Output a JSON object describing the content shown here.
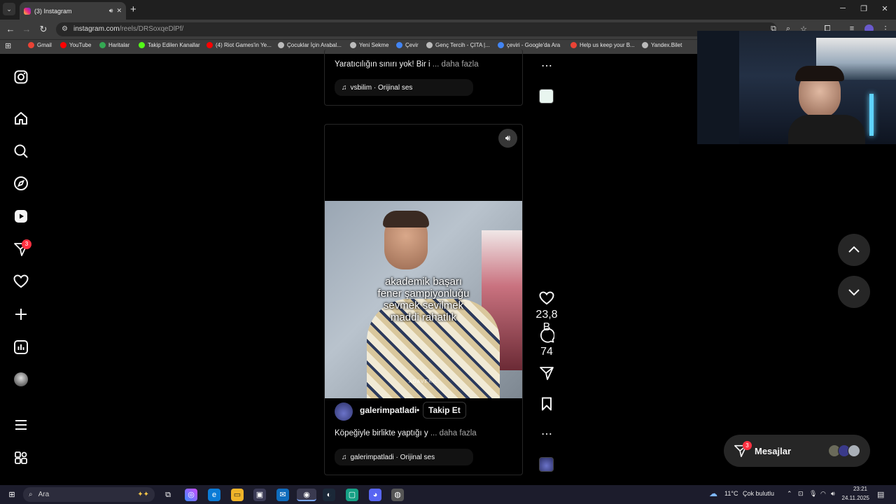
{
  "browser": {
    "tab_title": "(3) Instagram",
    "url_host": "instagram.com",
    "url_path": "/reels/DRSoxqeDlPf/",
    "bookmarks": [
      {
        "label": "Gmail",
        "icon": "gmail-icon",
        "color": "#ea4335"
      },
      {
        "label": "YouTube",
        "icon": "youtube-icon",
        "color": "#ff0000"
      },
      {
        "label": "Haritalar",
        "icon": "maps-icon",
        "color": "#34a853"
      },
      {
        "label": "Takip Edilen Kanallar",
        "icon": "kick-icon",
        "color": "#53fc18"
      },
      {
        "label": "(4) Riot Games'in Ye...",
        "icon": "youtube-icon",
        "color": "#ff0000"
      },
      {
        "label": "Çocuklar İçin Arabal...",
        "icon": "globe-icon",
        "color": "#bbbbbb"
      },
      {
        "label": "Yeni Sekme",
        "icon": "globe-icon",
        "color": "#bbbbbb"
      },
      {
        "label": "Çevir",
        "icon": "translate-icon",
        "color": "#4285f4"
      },
      {
        "label": "Genç Tercih - ÇITA |...",
        "icon": "globe-icon",
        "color": "#bbbbbb"
      },
      {
        "label": "çeviri - Google'da Ara",
        "icon": "google-icon",
        "color": "#4285f4"
      },
      {
        "label": "Help us keep your B...",
        "icon": "gmail-icon",
        "color": "#ea4335"
      },
      {
        "label": "Yandex.Bilet",
        "icon": "globe-icon",
        "color": "#bbbbbb"
      }
    ]
  },
  "sidebar": {
    "notification_count": "3"
  },
  "prev_post": {
    "caption": "Yaratıcılığın sınırı yok! Bir i",
    "more": "... daha fazla",
    "audio": "vsbilim · Orijinal ses"
  },
  "post": {
    "overlay_lines": [
      "akademik başarı",
      "fener şampiyonluğu",
      "sevmek sevilmek",
      "maddi rahatlık"
    ],
    "watermark": "ADAVEKİL",
    "username": "galerimpatladi",
    "separator": "•",
    "follow": "Takip Et",
    "caption": "Köpeğiyle birlikte yaptığı y",
    "more": "... daha fazla",
    "audio": "galerimpatladi · Orijinal ses",
    "likes": "23,8 B",
    "comments": "74"
  },
  "messages": {
    "label": "Mesajlar",
    "count": "3"
  },
  "taskbar": {
    "search": "Ara",
    "weather": "11°C",
    "weather_desc": "Çok bulutlu",
    "time": "23:21",
    "date": "24.11.2025"
  },
  "colors": {
    "accent_red": "#ff3040",
    "chrome_bar": "#3c3c3c",
    "panel": "#262626"
  }
}
